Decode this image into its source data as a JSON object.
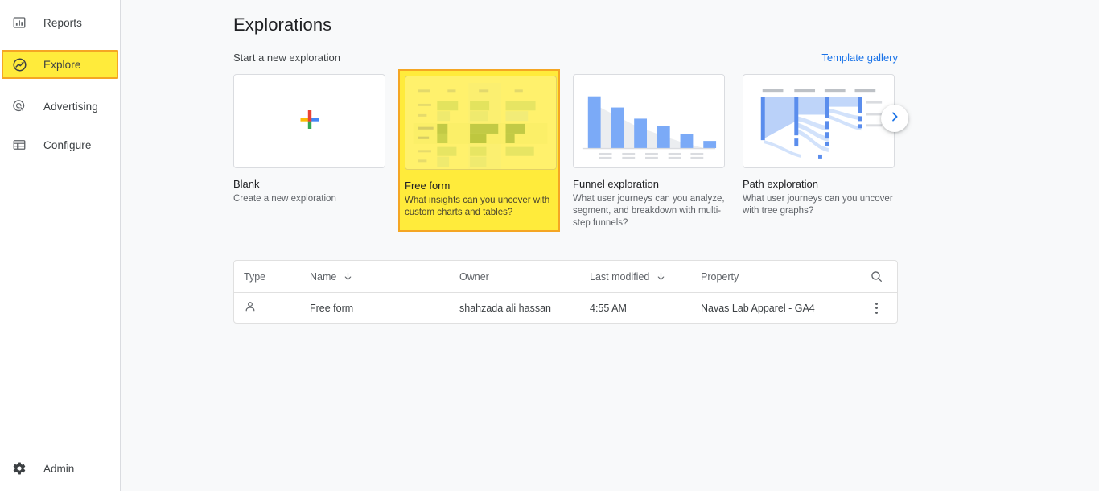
{
  "sidebar": {
    "items": [
      {
        "label": "Reports",
        "icon": "bar-chart-icon",
        "selected": false
      },
      {
        "label": "Explore",
        "icon": "explore-icon",
        "selected": true
      },
      {
        "label": "Advertising",
        "icon": "advertising-icon",
        "selected": false
      },
      {
        "label": "Configure",
        "icon": "configure-icon",
        "selected": false
      }
    ],
    "admin": {
      "label": "Admin",
      "icon": "gear-icon"
    }
  },
  "main": {
    "title": "Explorations",
    "subhead": "Start a new exploration",
    "template_gallery_label": "Template gallery",
    "carousel_next_icon": "chevron-right-icon",
    "cards": [
      {
        "id": "blank",
        "title": "Blank",
        "desc": "Create a new exploration",
        "thumb": "plus-icon",
        "highlighted": false
      },
      {
        "id": "free-form",
        "title": "Free form",
        "desc": "What insights can you uncover with custom charts and tables?",
        "thumb": "free-form-table-thumbnail",
        "highlighted": true
      },
      {
        "id": "funnel-exploration",
        "title": "Funnel exploration",
        "desc": "What user journeys can you analyze, segment, and breakdown with multi-step funnels?",
        "thumb": "funnel-bar-chart-thumbnail",
        "highlighted": false
      },
      {
        "id": "path-exploration",
        "title": "Path exploration",
        "desc": "What user journeys can you uncover with tree graphs?",
        "thumb": "path-sankey-thumbnail",
        "highlighted": false
      }
    ],
    "table": {
      "columns": [
        {
          "key": "type",
          "label": "Type",
          "sortable": false
        },
        {
          "key": "name",
          "label": "Name",
          "sortable": true
        },
        {
          "key": "owner",
          "label": "Owner",
          "sortable": false
        },
        {
          "key": "last_modified",
          "label": "Last modified",
          "sortable": true
        },
        {
          "key": "property",
          "label": "Property",
          "sortable": false
        }
      ],
      "search_icon": "search-icon",
      "rows": [
        {
          "type_icon": "person-icon",
          "name": "Free form",
          "owner": "shahzada ali hassan",
          "last_modified": "4:55 AM",
          "property": "Navas Lab Apparel - GA4",
          "actions_icon": "kebab-menu-icon"
        }
      ]
    }
  },
  "colors": {
    "accent_blue": "#1a73e8",
    "highlight_yellow": "#ffeb3b",
    "highlight_border": "#f5a623",
    "page_bg": "#f8f9fa",
    "text_primary": "#202124",
    "text_secondary": "#5f6368"
  }
}
